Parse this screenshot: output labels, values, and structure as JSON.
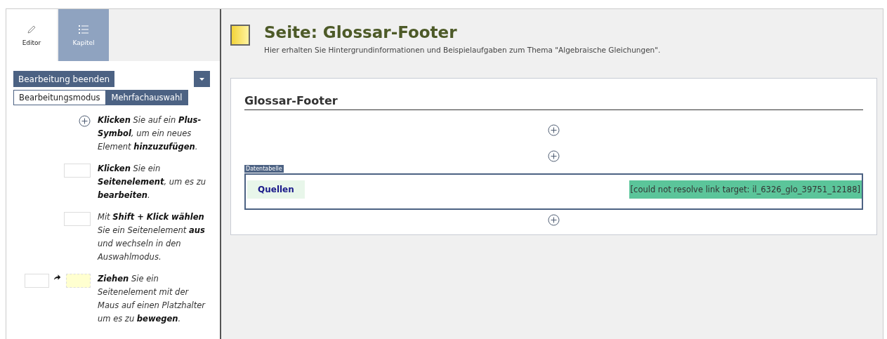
{
  "tabs": [
    {
      "label": "Editor",
      "kind": "pencil",
      "selected": true
    },
    {
      "label": "Kapitel",
      "kind": "list",
      "selected": false
    }
  ],
  "finish_button": {
    "label": "Bearbeitung beenden"
  },
  "modes": [
    {
      "label": "Bearbeitungsmodus",
      "selected": true
    },
    {
      "label": "Mehrfachauswahl",
      "selected": false
    }
  ],
  "help": [
    {
      "kind": "plus",
      "text": "**Klicken** Sie auf ein **Plus-Symbol**, um ein neues Element **hinzuzufügen**."
    },
    {
      "kind": "element",
      "text": "**Klicken** Sie ein **Seitenelement**, um es zu **bearbeiten**."
    },
    {
      "kind": "element",
      "text": "Mit **Shift + Klick wählen** Sie ein Seitenelement **aus** und wechseln in den Auswahlmodus."
    },
    {
      "kind": "drag",
      "text": "**Ziehen** Sie ein Seitenelement mit der Maus auf einen Platzhalter um es zu **bewegen**."
    }
  ],
  "page": {
    "title": "Seite: Glossar-Footer",
    "description": "Hier erhalten Sie Hintergrundinformationen und Beispielaufgaben zum Thema \"Algebraische Gleichungen\"."
  },
  "content": {
    "heading": "Glossar-Footer",
    "table_label": "Datentabelle",
    "cell": "Quellen",
    "link_error": "[could not resolve link target: il_6326_glo_39751_12188]"
  }
}
